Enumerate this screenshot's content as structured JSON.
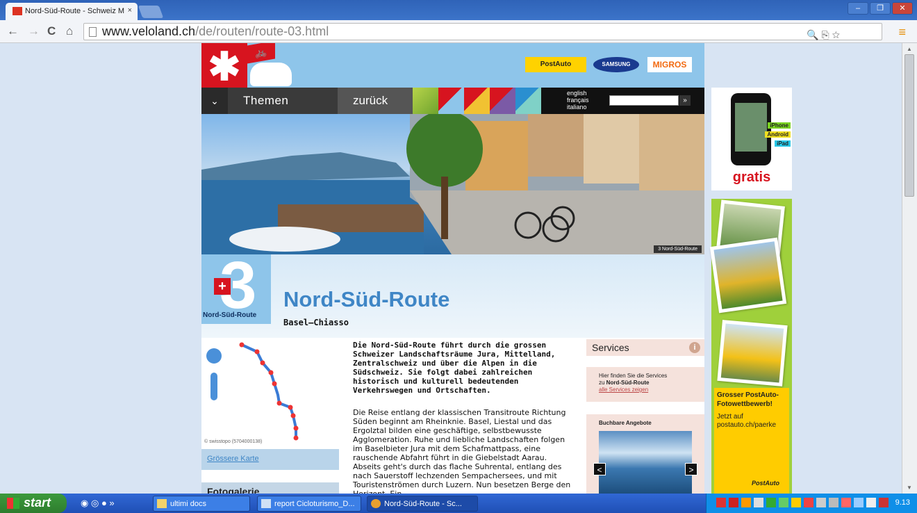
{
  "browser": {
    "tab_title": "Nord-Süd-Route - Schweiz M",
    "tab_close": "×",
    "window_buttons": [
      "–",
      "❐",
      "✕"
    ],
    "url_host": "www.veloland.ch",
    "url_path": "/de/routen/route-03.html",
    "back": "←",
    "forward": "→",
    "reload": "C",
    "home": "⌂",
    "omni_icons": "🔍 ⎘ ☆",
    "menu": "≡"
  },
  "site": {
    "sponsors": [
      "PostAuto",
      "SAMSUNG",
      "MIGROS"
    ],
    "nav": {
      "chevron": "⌄",
      "themen": "Themen",
      "zurueck": "zurück",
      "languages": [
        "english",
        "français",
        "italiano"
      ],
      "search_go": "»"
    },
    "hero_caption": "3 Nord-Süd-Route",
    "route": {
      "number": "3",
      "badge_label": "Nord-Süd-Route",
      "title": "Nord-Süd-Route",
      "subtitle": "Basel–Chiasso"
    },
    "map": {
      "copyright": "© swisstopo (5704000138)",
      "bigger_map": "Grössere Karte"
    },
    "fotogalerie": "Fotogalerie",
    "intro": "Die Nord-Süd-Route führt durch die grossen Schweizer Landschaftsräume Jura, Mittelland, Zentralschweiz und über die Alpen in die Südschweiz. Sie folgt dabei zahlreichen historisch und kulturell bedeutenden Verkehrswegen und Ortschaften.",
    "body": "Die Reise entlang der klassischen Transitroute Richtung Süden beginnt am Rheinknie. Basel, Liestal und das Ergolztal bilden eine geschäftige, selbstbewusste Agglomeration. Ruhe und liebliche Landschaften folgen im Baselbieter Jura mit dem Schafmattpass, eine rauschende Abfahrt führt in die Giebelstadt Aarau. Abseits geht's durch das flache Suhrental, entlang des nach Sauerstoff lechzenden Sempachersees, und mit Touristenströmen durch Luzern. Nun besetzen Berge den Horizont. Ein",
    "services": {
      "title": "Services",
      "info": "i",
      "text_pre": "Hier finden Sie die Services",
      "text_route_pre": "zu ",
      "text_route": "Nord-Süd-Route",
      "link": "alle Services zeigen"
    },
    "bookable": {
      "title": "Buchbare Angebote",
      "prev": "<",
      "next": ">"
    }
  },
  "ads": {
    "phone_tags": [
      "iPhone",
      "Android",
      "iPad"
    ],
    "gratis": "gratis",
    "post_title": "Grosser PostAuto-Fotowettbewerb!",
    "post_text": "Jetzt auf postauto.ch/paerke",
    "post_logo": "PostAuto"
  },
  "taskbar": {
    "start": "start",
    "quick_more": "»",
    "tasks": [
      "ultimi docs",
      "report Cicloturismo_D...",
      "Nord-Süd-Route - Sc..."
    ],
    "clock": "9.13"
  },
  "colors": {
    "accent_blue": "#3f86c6",
    "swiss_red": "#d7141f",
    "service_bg": "#f5e2dc"
  }
}
